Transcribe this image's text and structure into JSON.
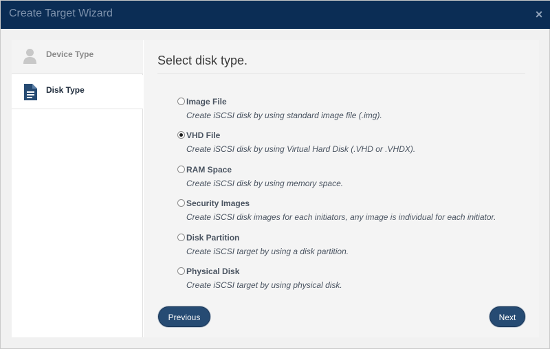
{
  "window": {
    "title": "Create Target Wizard",
    "close_glyph": "×"
  },
  "sidebar": {
    "items": [
      {
        "label": "Device Type",
        "icon": "user-icon",
        "active": false
      },
      {
        "label": "Disk Type",
        "icon": "document-icon",
        "active": true
      }
    ]
  },
  "main": {
    "heading": "Select disk type.",
    "options": [
      {
        "label": "Image File",
        "description": "Create iSCSI disk by using standard image file (.img).",
        "selected": false
      },
      {
        "label": "VHD File",
        "description": "Create iSCSI disk by using Virtual Hard Disk (.VHD or .VHDX).",
        "selected": true
      },
      {
        "label": "RAM Space",
        "description": "Create iSCSI disk by using memory space.",
        "selected": false
      },
      {
        "label": "Security Images",
        "description": "Create iSCSI disk images for each initiators, any image is individual for each initiator.",
        "selected": false
      },
      {
        "label": "Disk Partition",
        "description": "Create iSCSI target by using a disk partition.",
        "selected": false
      },
      {
        "label": "Physical Disk",
        "description": "Create iSCSI target by using physical disk.",
        "selected": false
      }
    ]
  },
  "footer": {
    "previous_label": "Previous",
    "next_label": "Next"
  },
  "colors": {
    "titlebar": "#0b2d55",
    "button": "#264b73"
  }
}
